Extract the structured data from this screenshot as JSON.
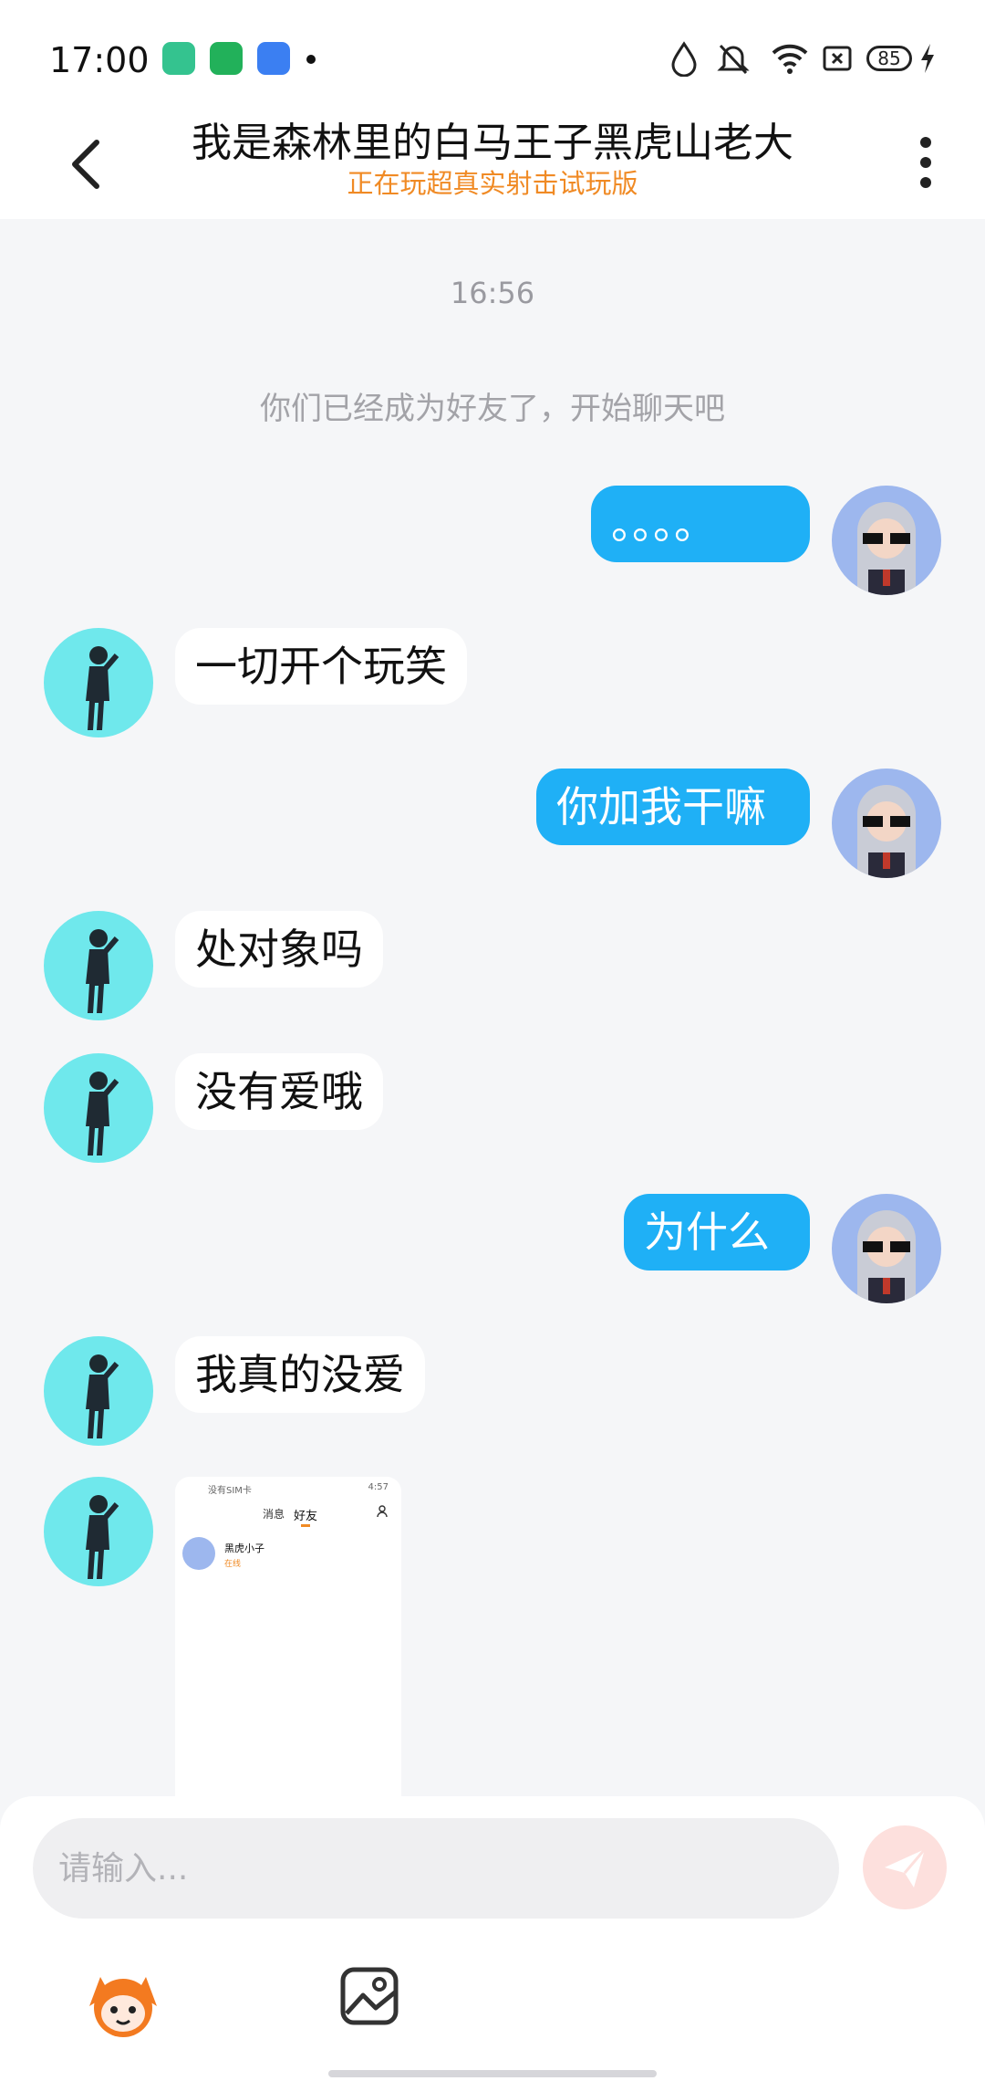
{
  "status_bar": {
    "time": "17:00",
    "battery": "85",
    "icons": [
      "mic-app-icon",
      "android-app-icon",
      "chat-app-icon",
      "notification-dot",
      "water-drop-icon",
      "mute-bell-icon",
      "wifi-icon",
      "sim-x-icon",
      "battery-icon",
      "charging-icon"
    ]
  },
  "header": {
    "title": "我是森林里的白马王子黑虎山老大",
    "subtitle": "正在玩超真实射击试玩版",
    "back_icon": "chevron-left-icon",
    "more_icon": "more-vertical-icon"
  },
  "chat": {
    "timestamp": "16:56",
    "system_message": "你们已经成为好友了，开始聊天吧",
    "messages": [
      {
        "from": "me",
        "text": "。。。。"
      },
      {
        "from": "other",
        "text": "一切开个玩笑"
      },
      {
        "from": "me",
        "text": "你加我干嘛"
      },
      {
        "from": "other",
        "text": "处对象吗"
      },
      {
        "from": "other",
        "text": "没有爱哦"
      },
      {
        "from": "me",
        "text": "为什么"
      },
      {
        "from": "other",
        "text": "我真的没爱"
      },
      {
        "from": "other",
        "type": "image"
      }
    ],
    "screenshot_preview": {
      "status_left": "没有SIM卡",
      "status_right": "4:57",
      "tab_messages": "消息",
      "tab_friends": "好友",
      "friend_name": "黑虎小子",
      "friend_status": "在线"
    }
  },
  "input": {
    "placeholder": "请输入..."
  },
  "colors": {
    "my_bubble": "#1fb0f6",
    "accent_orange": "#f08a24",
    "send_button": "#fde0dd"
  }
}
